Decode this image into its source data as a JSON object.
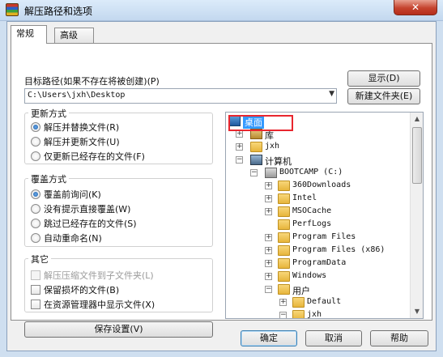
{
  "window": {
    "title": "解压路径和选项",
    "close_glyph": "✕"
  },
  "tabs": [
    "常规",
    "高级"
  ],
  "target_path": {
    "label": "目标路径(如果不存在将被创建)(P)",
    "value": "C:\\Users\\jxh\\Desktop"
  },
  "buttons": {
    "show": "显示(D)",
    "new_folder": "新建文件夹(E)",
    "save_settings": "保存设置(V)",
    "ok": "确定",
    "cancel": "取消",
    "help": "帮助"
  },
  "update_mode": {
    "title": "更新方式",
    "options": [
      "解压并替换文件(R)",
      "解压并更新文件(U)",
      "仅更新已经存在的文件(F)"
    ],
    "selected": 0
  },
  "overwrite_mode": {
    "title": "覆盖方式",
    "options": [
      "覆盖前询问(K)",
      "没有提示直接覆盖(W)",
      "跳过已经存在的文件(S)",
      "自动重命名(N)"
    ],
    "selected": 0
  },
  "misc": {
    "title": "其它",
    "options": [
      "解压压缩文件到子文件夹(L)",
      "保留损坏的文件(B)",
      "在资源管理器中显示文件(X)"
    ]
  },
  "tree": {
    "nodes": [
      "桌面",
      "库",
      "jxh",
      "计算机",
      "BOOTCAMP (C:)",
      "360Downloads",
      "Intel",
      "MSOCache",
      "PerfLogs",
      "Program Files",
      "Program Files (x86)",
      "ProgramData",
      "Windows",
      "用户",
      "Default",
      "jxh"
    ]
  }
}
